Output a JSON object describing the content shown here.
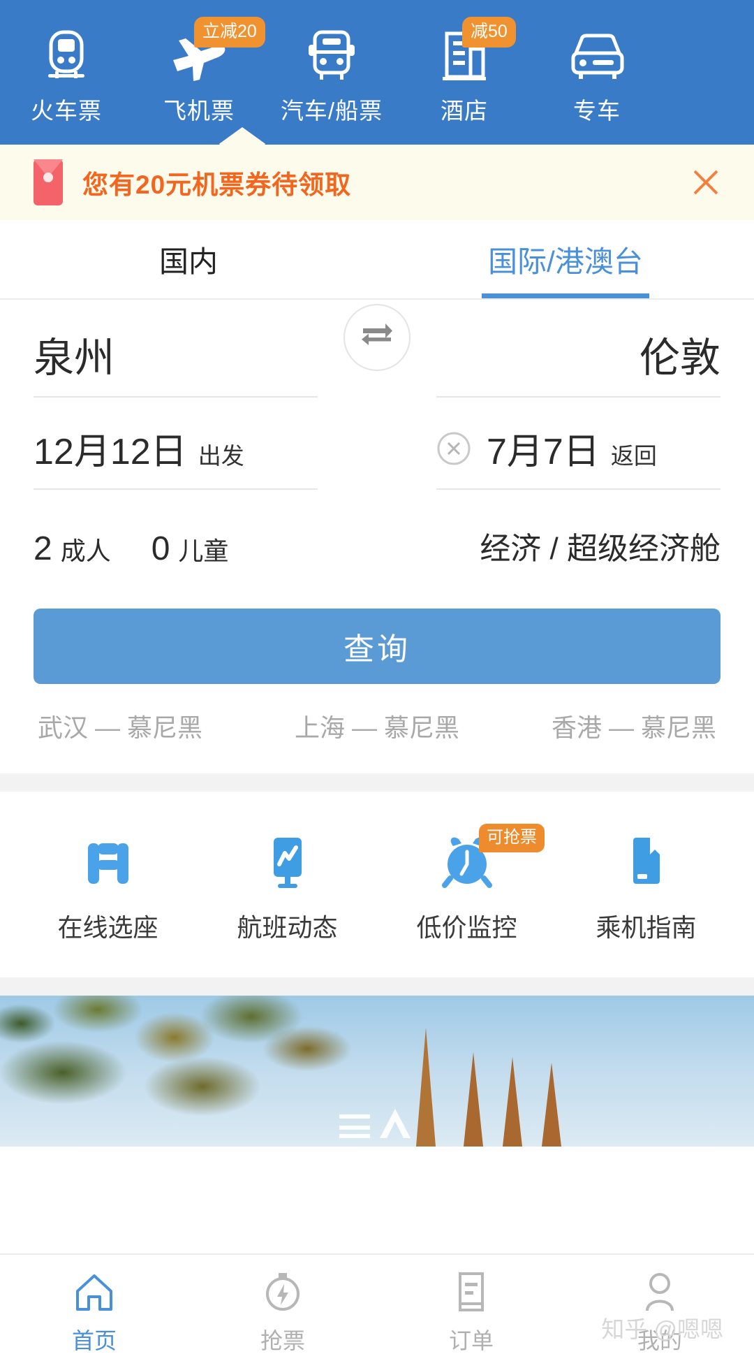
{
  "topnav": {
    "background_color": "#3a7bc8",
    "items": [
      {
        "label": "火车票",
        "icon": "train-icon",
        "badge": null
      },
      {
        "label": "飞机票",
        "icon": "airplane-icon",
        "badge": "立减20",
        "active": true
      },
      {
        "label": "汽车/船票",
        "icon": "bus-icon",
        "badge": null
      },
      {
        "label": "酒店",
        "icon": "hotel-icon",
        "badge": "减50"
      },
      {
        "label": "专车",
        "icon": "car-icon",
        "badge": null
      }
    ]
  },
  "coupon": {
    "text": "您有20元机票券待领取",
    "icon": "red-envelope-icon",
    "close_icon": "close-icon",
    "text_color": "#f2661f",
    "background_color": "#fdfbec"
  },
  "segment_tabs": {
    "items": [
      {
        "label": "国内",
        "active": false
      },
      {
        "label": "国际/港澳台",
        "active": true
      }
    ],
    "active_color": "#4a90d9"
  },
  "search_form": {
    "from_city": "泉州",
    "to_city": "伦敦",
    "swap_icon": "swap-arrows-icon",
    "depart_date": "12月12日",
    "depart_label": "出发",
    "return_date": "7月7日",
    "return_label": "返回",
    "return_clear_icon": "clear-circle-icon",
    "adults_count": "2",
    "adults_label": "成人",
    "children_count": "0",
    "children_label": "儿童",
    "cabin_class": "经济 / 超级经济舱",
    "search_button": "查询",
    "search_button_color": "#5b9bd5"
  },
  "popular_routes": [
    "武汉 — 慕尼黑",
    "上海 — 慕尼黑",
    "香港 — 慕尼黑"
  ],
  "features": [
    {
      "label": "在线选座",
      "icon": "seat-icon",
      "badge": null
    },
    {
      "label": "航班动态",
      "icon": "flight-status-monitor-icon",
      "badge": null
    },
    {
      "label": "低价监控",
      "icon": "alarm-clock-icon",
      "badge": "可抢票"
    },
    {
      "label": "乘机指南",
      "icon": "guide-book-icon",
      "badge": null
    }
  ],
  "tabbar": {
    "items": [
      {
        "label": "首页",
        "icon": "home-icon",
        "active": true
      },
      {
        "label": "抢票",
        "icon": "stopwatch-bolt-icon",
        "active": false
      },
      {
        "label": "订单",
        "icon": "order-list-icon",
        "active": false
      },
      {
        "label": "我的",
        "icon": "person-icon",
        "active": false
      }
    ],
    "active_color": "#4a90d9",
    "inactive_color": "#b0b0b0"
  },
  "watermark": "知乎 @嗯嗯"
}
